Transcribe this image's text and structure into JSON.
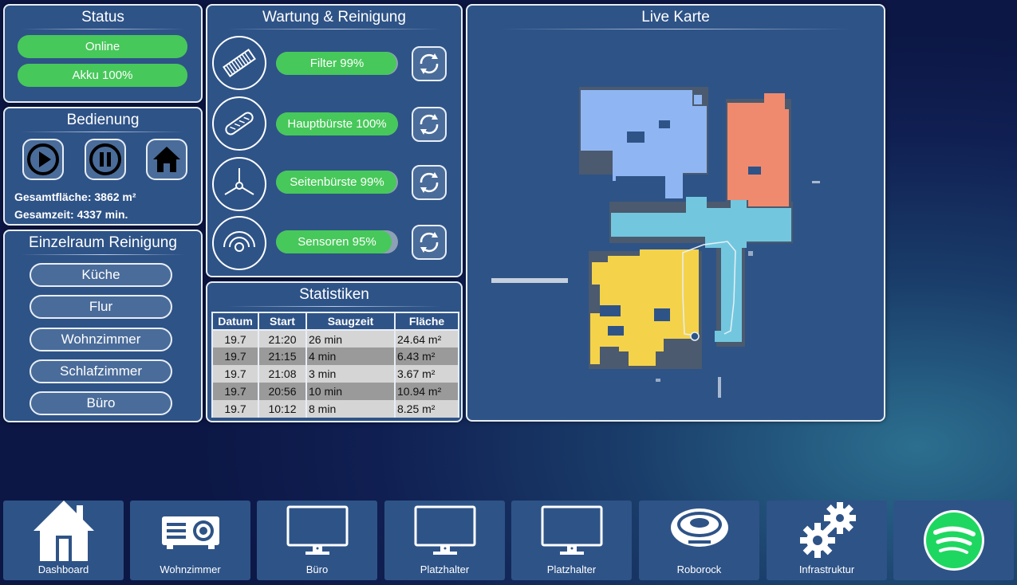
{
  "status": {
    "title": "Status",
    "online": "Online",
    "battery": "Akku 100%"
  },
  "control": {
    "title": "Bedienung",
    "total_area": "Gesamtfläche: 3862 m²",
    "total_time": "Gesamzeit: 4337 min."
  },
  "rooms": {
    "title": "Einzelraum Reinigung",
    "items": [
      {
        "label": "Küche"
      },
      {
        "label": "Flur"
      },
      {
        "label": "Wohnzimmer"
      },
      {
        "label": "Schlafzimmer"
      },
      {
        "label": "Büro"
      }
    ]
  },
  "maintenance": {
    "title": "Wartung & Reinigung",
    "items": [
      {
        "label": "Filter 99%",
        "percent": 99,
        "icon": "filter-icon"
      },
      {
        "label": "Hauptbürste 100%",
        "percent": 100,
        "icon": "main-brush-icon"
      },
      {
        "label": "Seitenbürste 99%",
        "percent": 99,
        "icon": "side-brush-icon"
      },
      {
        "label": "Sensoren 95%",
        "percent": 95,
        "icon": "sensor-icon"
      }
    ]
  },
  "stats": {
    "title": "Statistiken",
    "headers": [
      "Datum",
      "Start",
      "Saugzeit",
      "Fläche"
    ],
    "rows": [
      [
        "19.7",
        "21:20",
        "26 min",
        "24.64 m²"
      ],
      [
        "19.7",
        "21:15",
        "4 min",
        "6.43 m²"
      ],
      [
        "19.7",
        "21:08",
        "3 min",
        "3.67 m²"
      ],
      [
        "19.7",
        "20:56",
        "10 min",
        "10.94 m²"
      ],
      [
        "19.7",
        "10:12",
        "8 min",
        "8.25 m²"
      ]
    ]
  },
  "map": {
    "title": "Live Karte"
  },
  "nav": [
    {
      "label": "Dashboard",
      "icon": "house-icon"
    },
    {
      "label": "Wohnzimmer",
      "icon": "projector-icon"
    },
    {
      "label": "Büro",
      "icon": "monitor-icon"
    },
    {
      "label": "Platzhalter",
      "icon": "monitor-icon"
    },
    {
      "label": "Platzhalter",
      "icon": "monitor-icon"
    },
    {
      "label": "Roborock",
      "icon": "robot-vacuum-icon"
    },
    {
      "label": "Infrastruktur",
      "icon": "gears-icon"
    },
    {
      "label": "",
      "icon": "spotify-icon"
    }
  ],
  "colors": {
    "panel": "#2e5387",
    "green": "#47c85a",
    "room_blue": "#8fb6f2",
    "room_orange": "#ef8a6e",
    "room_cyan": "#72c7df",
    "room_yellow": "#f4d24a",
    "spotify": "#1ed760"
  }
}
